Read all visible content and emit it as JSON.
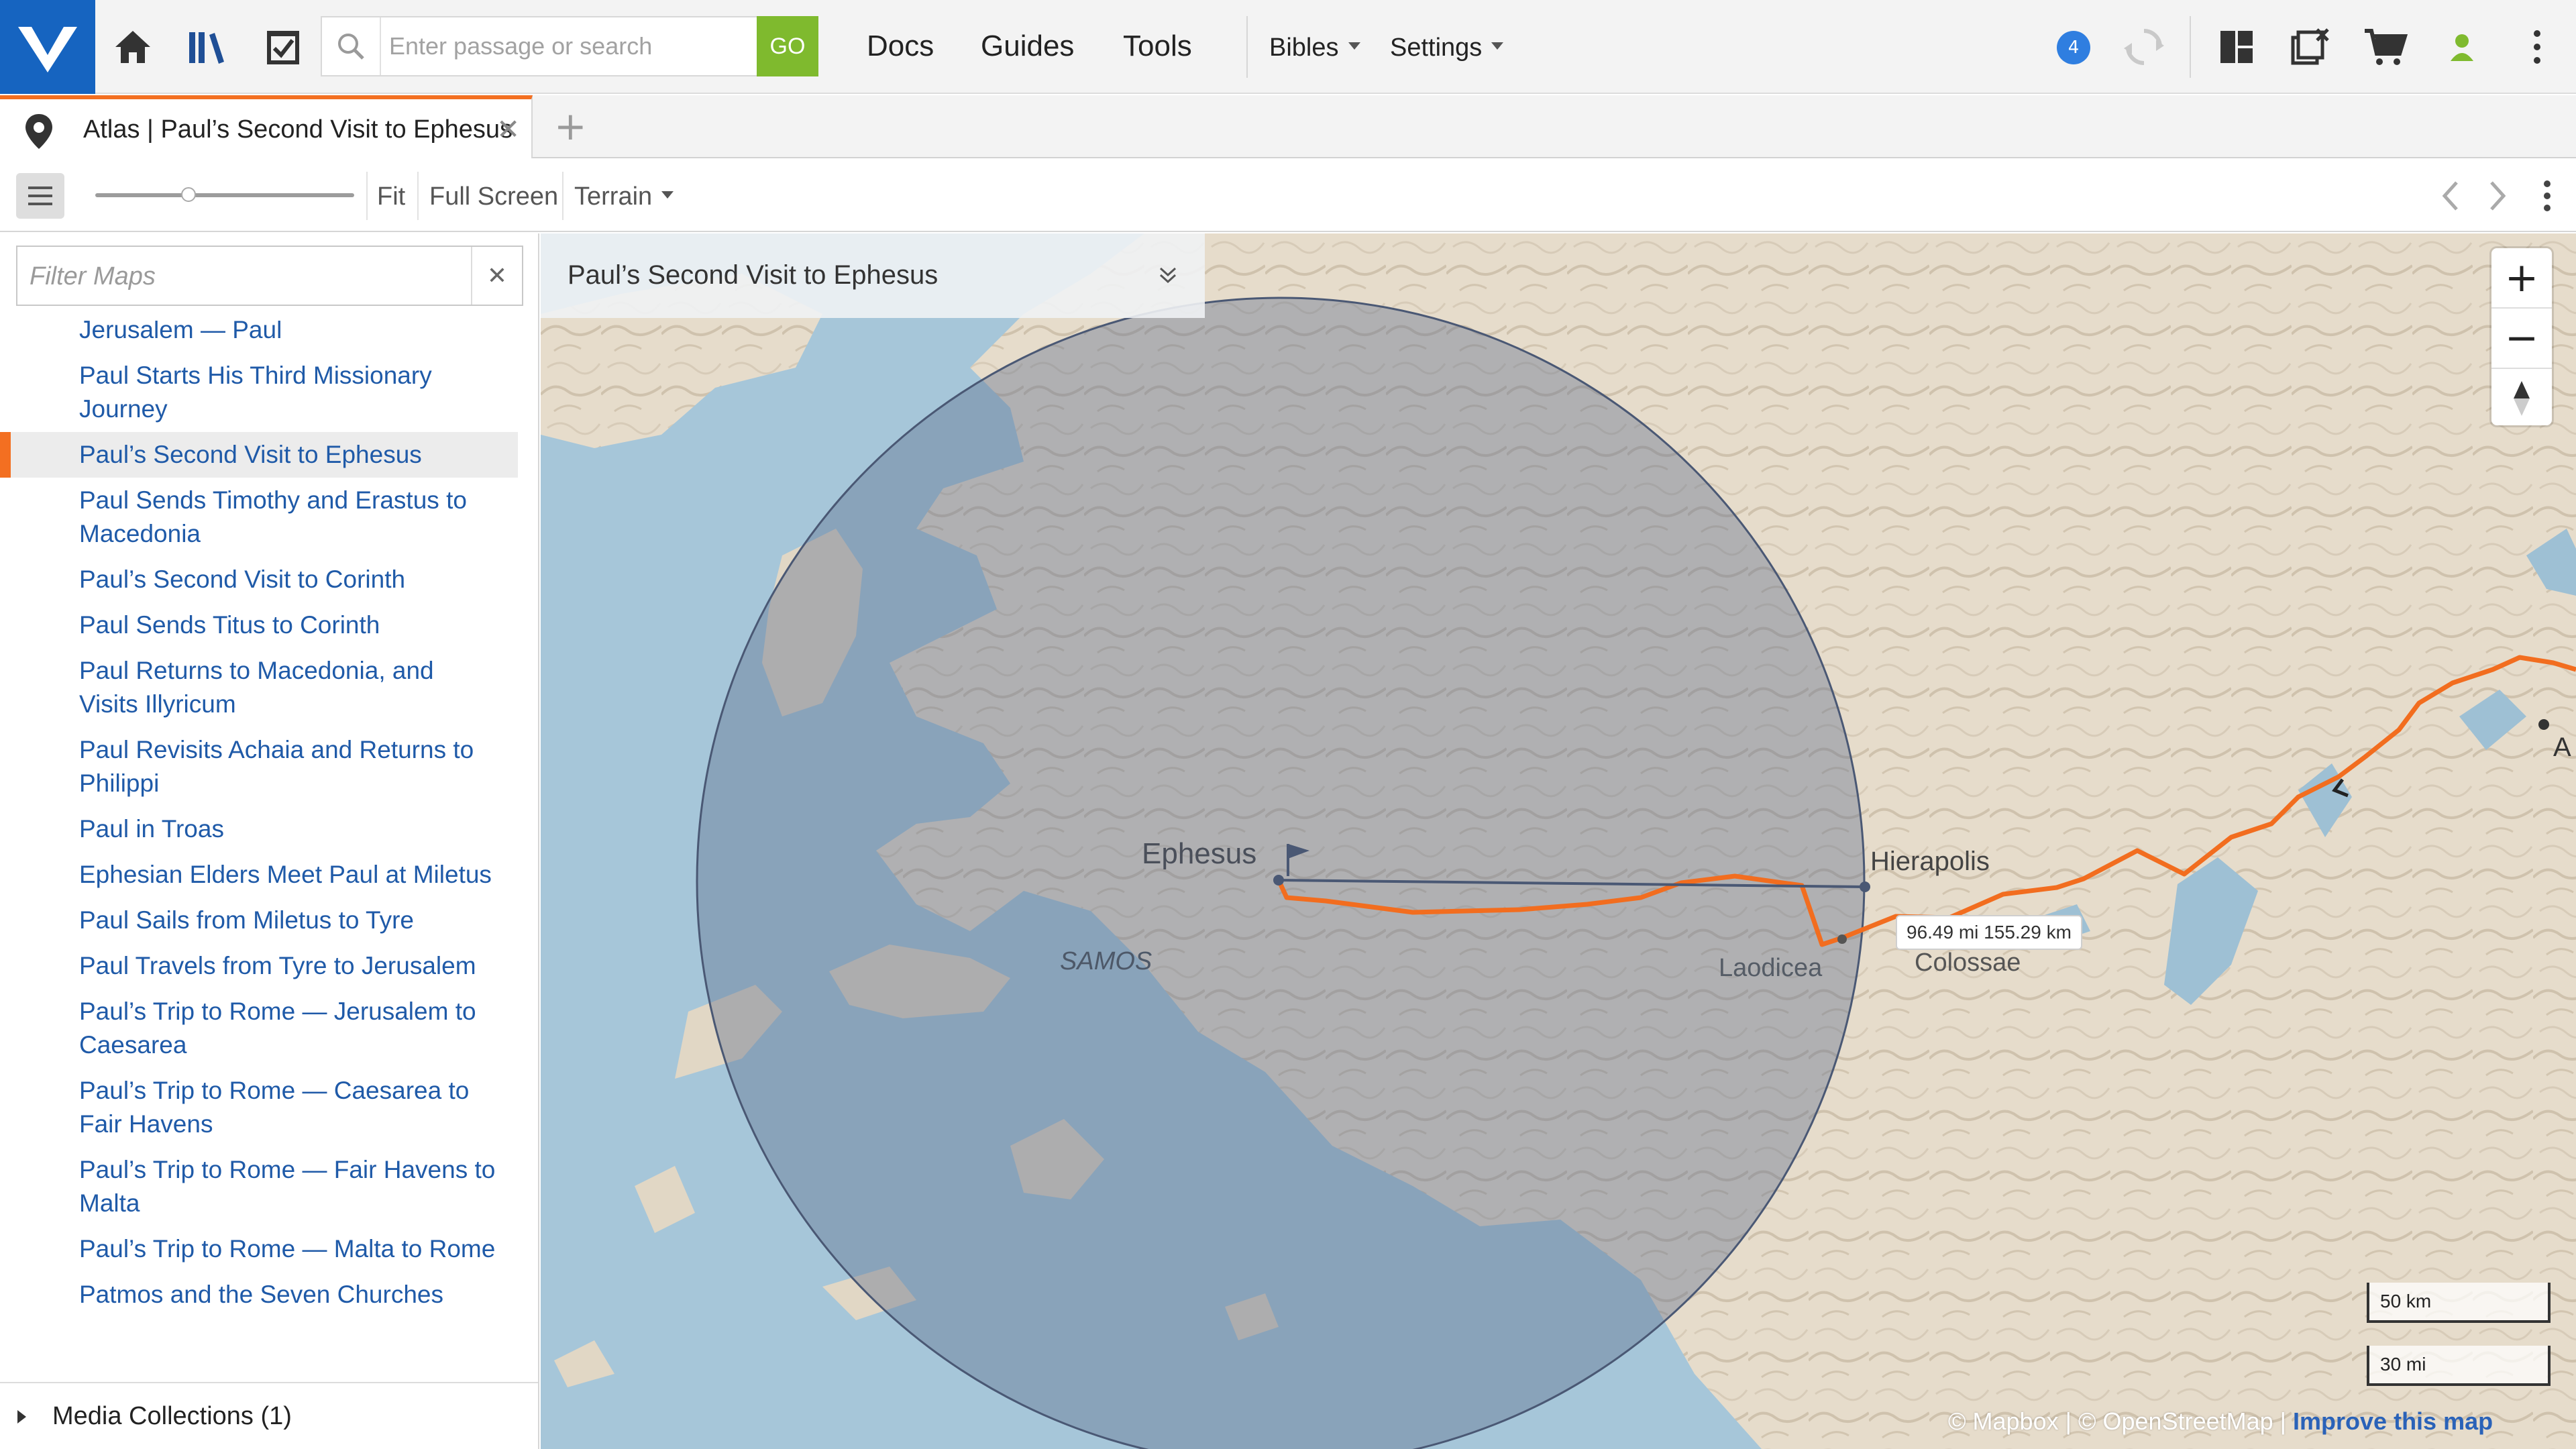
{
  "topbar": {
    "search_placeholder": "Enter passage or search",
    "go_label": "GO",
    "nav": [
      "Docs",
      "Guides",
      "Tools"
    ],
    "bibles_label": "Bibles",
    "settings_label": "Settings",
    "notifications_count": "4"
  },
  "tab": {
    "title": "Atlas | Paul’s Second Visit to Ephesus",
    "close_glyph": "✕",
    "new_glyph": "+"
  },
  "toolbar": {
    "fit_label": "Fit",
    "fullscreen_label": "Full Screen",
    "terrain_label": "Terrain",
    "zoom_fraction": 0.36
  },
  "sidebar": {
    "filter_placeholder": "Filter Maps",
    "clear_glyph": "✕",
    "partial_item": "Jerusalem — Paul",
    "items": [
      "Paul Starts His Third Missionary Journey",
      "Paul’s Second Visit to Ephesus",
      "Paul Sends Timothy and Erastus to Macedonia",
      "Paul’s Second Visit to Corinth",
      "Paul Sends Titus to Corinth",
      "Paul Returns to Macedonia, and Visits Illyricum",
      "Paul Revisits Achaia and Returns to Philippi",
      "Paul in Troas",
      "Ephesian Elders Meet Paul at Miletus",
      "Paul Sails from Miletus to Tyre",
      "Paul Travels from Tyre to Jerusalem",
      "Paul’s Trip to Rome — Jerusalem to Caesarea",
      "Paul’s Trip to Rome — Caesarea to Fair Havens",
      "Paul’s Trip to Rome — Fair Havens to Malta",
      "Paul’s Trip to Rome — Malta to Rome",
      "Patmos and the Seven Churches"
    ],
    "selected_index": 1,
    "media_label": "Media Collections (1)"
  },
  "map": {
    "title": "Paul’s Second Visit to Ephesus",
    "zoom_in": "+",
    "zoom_out": "−",
    "places": {
      "ephesus": "Ephesus",
      "samos": "SAMOS",
      "hierapolis": "Hierapolis",
      "laodicea": "Laodicea",
      "colossae": "Colossae",
      "edge_label": "A"
    },
    "measurement": "96.49 mi 155.29 km",
    "scale_km": "50 km",
    "scale_mi": "30 mi",
    "attribution": {
      "mapbox": "© Mapbox",
      "osm": "© OpenStreetMap",
      "improve": "Improve this map"
    },
    "colors": {
      "route": "#f26d1f",
      "water": "#a6c6d9",
      "land": "#e6dccb",
      "accent": "#f36f21",
      "brand": "#1664c0",
      "go_button": "#7fba2e",
      "link": "#1f5aa8"
    }
  }
}
